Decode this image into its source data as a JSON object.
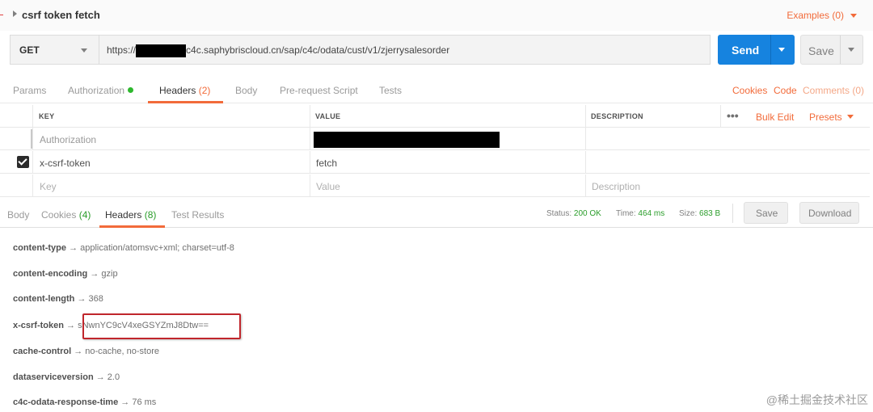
{
  "request": {
    "title": "csrf token fetch",
    "examples_label": "Examples (0)",
    "method": "GET",
    "url_prefix": "https://",
    "url_suffix": "c4c.saphybriscloud.cn/sap/c4c/odata/cust/v1/zjerrysalesorder",
    "send_label": "Send",
    "save_label": "Save"
  },
  "request_tabs": {
    "params": "Params",
    "authorization": "Authorization",
    "headers": "Headers",
    "headers_count": "(2)",
    "body": "Body",
    "prerequest": "Pre-request Script",
    "tests": "Tests",
    "cookies": "Cookies",
    "code": "Code",
    "comments": "Comments (0)"
  },
  "headers_table": {
    "col_key": "KEY",
    "col_value": "VALUE",
    "col_description": "DESCRIPTION",
    "more": "•••",
    "bulk_edit": "Bulk Edit",
    "presets": "Presets",
    "rows": [
      {
        "key": "Authorization",
        "value": "",
        "description": "",
        "checked": false
      },
      {
        "key": "x-csrf-token",
        "value": "fetch",
        "description": "",
        "checked": true
      }
    ],
    "new_row": {
      "key": "Key",
      "value": "Value",
      "description": "Description"
    }
  },
  "response_tabs": {
    "body": "Body",
    "cookies": "Cookies",
    "cookies_count": "(4)",
    "headers": "Headers",
    "headers_count": "(8)",
    "test_results": "Test Results"
  },
  "response_meta": {
    "status_label": "Status:",
    "status_value": "200 OK",
    "time_label": "Time:",
    "time_value": "464 ms",
    "size_label": "Size:",
    "size_value": "683 B",
    "save_label": "Save",
    "download_label": "Download"
  },
  "response_headers": [
    {
      "key": "content-type",
      "arrow": "→",
      "value": "application/atomsvc+xml; charset=utf-8"
    },
    {
      "key": "content-encoding",
      "arrow": "→",
      "value": "gzip"
    },
    {
      "key": "content-length",
      "arrow": "→",
      "value": "368"
    },
    {
      "key": "x-csrf-token",
      "arrow": "→",
      "value": "sNwnYC9cV4xeGSYZmJ8Dtw=="
    },
    {
      "key": "cache-control",
      "arrow": "→",
      "value": "no-cache, no-store"
    },
    {
      "key": "dataserviceversion",
      "arrow": "→",
      "value": "2.0"
    },
    {
      "key": "c4c-odata-response-time",
      "arrow": "→",
      "value": "76 ms"
    }
  ],
  "watermark": "@稀土掘金技术社区",
  "colors": {
    "accent": "#f26b3a",
    "send": "#1683df",
    "status_ok": "#2a9d2a",
    "highlight": "#c0262c"
  }
}
